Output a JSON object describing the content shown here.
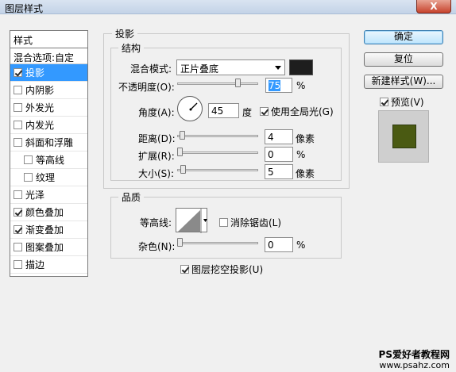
{
  "window": {
    "title": "图层样式",
    "close_glyph": "X"
  },
  "left": {
    "header": "样式",
    "blend": "混合选项:自定",
    "items": [
      {
        "label": "投影",
        "checked": true,
        "selected": true,
        "sub": false
      },
      {
        "label": "内阴影",
        "checked": false,
        "selected": false,
        "sub": false
      },
      {
        "label": "外发光",
        "checked": false,
        "selected": false,
        "sub": false
      },
      {
        "label": "内发光",
        "checked": false,
        "selected": false,
        "sub": false
      },
      {
        "label": "斜面和浮雕",
        "checked": false,
        "selected": false,
        "sub": false
      },
      {
        "label": "等高线",
        "checked": false,
        "selected": false,
        "sub": true
      },
      {
        "label": "纹理",
        "checked": false,
        "selected": false,
        "sub": true
      },
      {
        "label": "光泽",
        "checked": false,
        "selected": false,
        "sub": false
      },
      {
        "label": "颜色叠加",
        "checked": true,
        "selected": false,
        "sub": false
      },
      {
        "label": "渐变叠加",
        "checked": true,
        "selected": false,
        "sub": false
      },
      {
        "label": "图案叠加",
        "checked": false,
        "selected": false,
        "sub": false
      },
      {
        "label": "描边",
        "checked": false,
        "selected": false,
        "sub": false
      }
    ]
  },
  "shadow": {
    "section_title": "投影",
    "structure_title": "结构",
    "blend_mode_label": "混合模式:",
    "blend_mode_value": "正片叠底",
    "shadow_color": "#1e1e1e",
    "opacity_label": "不透明度(O):",
    "opacity_value": "75",
    "opacity_unit": "%",
    "opacity_level": 0.75,
    "angle_label": "角度(A):",
    "angle_value": "45",
    "angle_unit": "度",
    "global_light_label": "使用全局光(G)",
    "global_light_checked": true,
    "distance_label": "距离(D):",
    "distance_value": "4",
    "distance_unit": "像素",
    "spread_label": "扩展(R):",
    "spread_value": "0",
    "spread_unit": "%",
    "size_label": "大小(S):",
    "size_value": "5",
    "size_unit": "像素"
  },
  "quality": {
    "title": "品质",
    "contour_label": "等高线:",
    "antialias_label": "消除锯齿(L)",
    "antialias_checked": false,
    "noise_label": "杂色(N):",
    "noise_value": "0",
    "noise_unit": "%",
    "knockout_label": "图层挖空投影(U)",
    "knockout_checked": true
  },
  "buttons": {
    "ok": "确定",
    "reset": "复位",
    "new_style": "新建样式(W)...",
    "preview_label": "预览(V)",
    "preview_checked": true,
    "preview_color": "#4a5a12"
  },
  "watermark": {
    "line1": "PS爱好者教程网",
    "line2": "www.psahz.com"
  }
}
